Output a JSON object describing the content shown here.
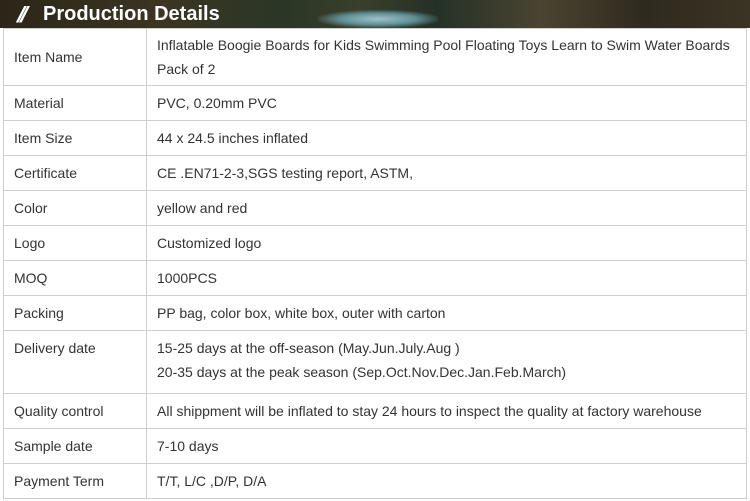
{
  "banner": {
    "title": "Production Details",
    "marker": "//"
  },
  "rows": [
    {
      "label": "Item Name",
      "lines": [
        "Inflatable Boogie Boards for Kids Swimming Pool Floating Toys Learn to Swim Water Boards",
        "Pack of 2"
      ]
    },
    {
      "label": "Material",
      "lines": [
        "PVC, 0.20mm PVC"
      ]
    },
    {
      "label": "Item Size",
      "lines": [
        "44 x 24.5 inches inflated"
      ]
    },
    {
      "label": "Certificate",
      "lines": [
        "CE .EN71-2-3,SGS testing report, ASTM,"
      ]
    },
    {
      "label": "Color",
      "lines": [
        "yellow and red"
      ]
    },
    {
      "label": "Logo",
      "lines": [
        "Customized logo"
      ]
    },
    {
      "label": "MOQ",
      "lines": [
        "1000PCS"
      ]
    },
    {
      "label": "Packing",
      "lines": [
        "PP bag, color box, white box, outer with carton"
      ]
    },
    {
      "label": "Delivery date",
      "lines": [
        "15-25 days at the off-season (May.Jun.July.Aug )",
        "20-35 days at the peak season (Sep.Oct.Nov.Dec.Jan.Feb.March)"
      ]
    },
    {
      "label": "Quality control",
      "lines": [
        "All shippment will be inflated to stay 24 hours to inspect the quality at factory warehouse"
      ]
    },
    {
      "label": "Sample date",
      "lines": [
        "7-10 days"
      ]
    },
    {
      "label": "Payment Term",
      "lines": [
        "T/T, L/C ,D/P, D/A"
      ]
    }
  ]
}
